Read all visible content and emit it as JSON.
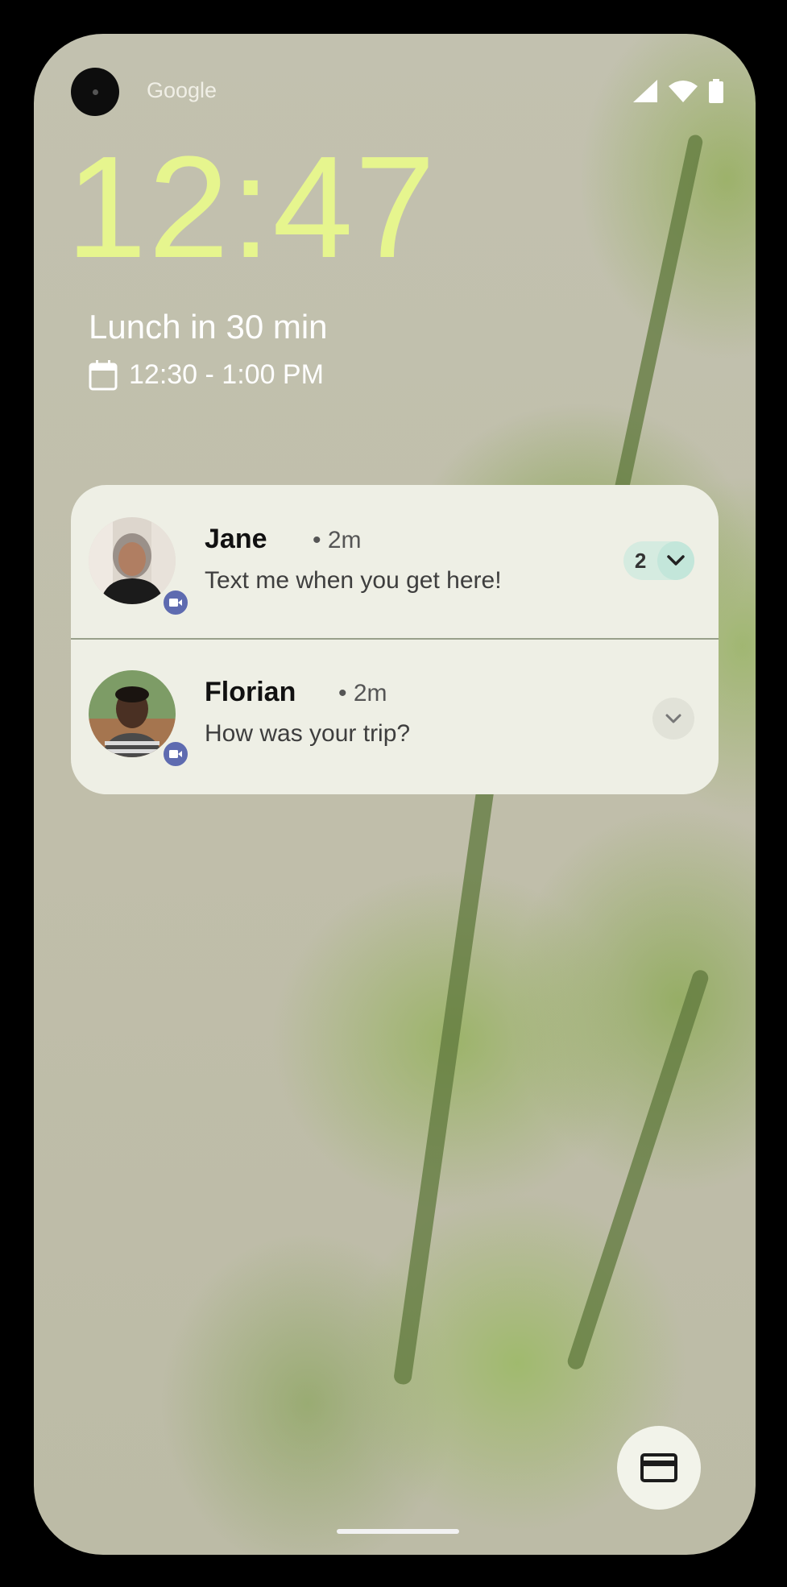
{
  "status_bar": {
    "carrier": "Google",
    "icons": [
      "signal-icon",
      "wifi-icon",
      "battery-icon"
    ]
  },
  "lock_screen": {
    "time": "12:47",
    "event": {
      "title": "Lunch in 30 min",
      "time": "12:30 - 1:00 PM",
      "icon": "calendar-icon"
    }
  },
  "notifications": [
    {
      "sender": "Jane",
      "time": "• 2m",
      "message": "Text me when you get here!",
      "count": "2",
      "app_icon": "video-icon"
    },
    {
      "sender": "Florian",
      "time": "• 2m",
      "message": "How was your trip?",
      "app_icon": "video-icon"
    }
  ],
  "shortcuts": {
    "wallet_icon": "credit-card-icon"
  },
  "colors": {
    "clock": "#e6f58e",
    "card_bg": "#eeefe5",
    "badge": "#5e6bb0",
    "count_pill": "#d5ebe0"
  }
}
